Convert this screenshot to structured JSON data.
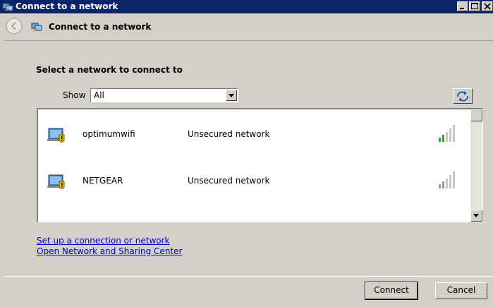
{
  "window": {
    "title": "Connect to a network"
  },
  "nav": {
    "title": "Connect to a network"
  },
  "main": {
    "heading": "Select a network to connect to",
    "show_label": "Show",
    "filter_value": "All",
    "networks": [
      {
        "name": "optimumwifi",
        "security": "Unsecured network",
        "signal_bars": 5,
        "signal_strength": 2
      },
      {
        "name": "NETGEAR",
        "security": "Unsecured network",
        "signal_bars": 5,
        "signal_strength": 2
      }
    ],
    "links": [
      "Set up a connection or network",
      "Open Network and Sharing Center"
    ]
  },
  "footer": {
    "connect_label": "Connect",
    "cancel_label": "Cancel"
  },
  "colors": {
    "titlebar": "#0a246a",
    "window_bg": "#d4d0c8",
    "link": "#0000cc",
    "signal_active": "#2fa52f"
  },
  "icons": {
    "title": "network-icon",
    "back": "back-arrow-icon",
    "refresh": "refresh-icon",
    "network": "wireless-network-warning-icon",
    "signal": "signal-strength-icon"
  }
}
